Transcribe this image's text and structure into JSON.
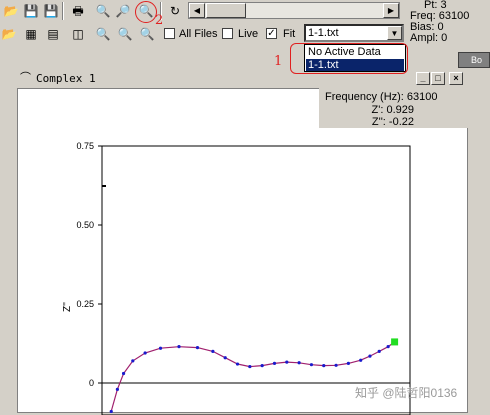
{
  "toolbar1": {
    "icons": [
      "open-icon",
      "save-icon",
      "save-all-icon",
      "print-icon",
      "zoom-fit-icon",
      "zoom-area-icon",
      "zoom-select-icon",
      "refresh-icon"
    ]
  },
  "toolbar2": {
    "icons": [
      "open-folder-icon",
      "table-icon",
      "data-grid-icon",
      "split-icon",
      "zoom-out-icon",
      "zoom-in-icon",
      "zoom-reset-icon"
    ],
    "all_files_label": "All Files",
    "live_label": "Live",
    "fit_label": "Fit",
    "all_files_checked": false,
    "live_checked": false,
    "fit_checked": true
  },
  "status": {
    "pt": "Pt: 3",
    "freq": "Freq: 63100",
    "bias": "Bias: 0",
    "ampl": "Ampl: 0"
  },
  "combo": {
    "value": "1-1.txt",
    "options": [
      "No Active Data",
      "1-1.txt"
    ],
    "selected_index": 1
  },
  "annotations": {
    "num1": "1",
    "num2": "2",
    "color": "#e02020"
  },
  "side_tab": {
    "label": "Bo"
  },
  "window": {
    "title": "Complex 1",
    "min_label": "_",
    "max_label": "□",
    "close_label": "×"
  },
  "info": {
    "freq": "Frequency (Hz): 63100",
    "zr": "Z': 0.929",
    "zi": "Z'': -0.22"
  },
  "watermark": "知乎 @陆哲阳0136",
  "chart_data": {
    "type": "line",
    "ylabel": "Z''",
    "xlabel": "",
    "ylim": [
      -0.1,
      0.75
    ],
    "yticks": [
      0,
      0.25,
      0.5,
      0.75
    ],
    "ytick_labels": [
      "0",
      "0.25",
      "0.50",
      "0.75"
    ],
    "series": [
      {
        "color": "#a0206e",
        "marker_color": "#1a1acc",
        "points": [
          [
            0.03,
            -0.09
          ],
          [
            0.05,
            -0.02
          ],
          [
            0.07,
            0.03
          ],
          [
            0.1,
            0.07
          ],
          [
            0.14,
            0.095
          ],
          [
            0.19,
            0.11
          ],
          [
            0.25,
            0.115
          ],
          [
            0.31,
            0.112
          ],
          [
            0.36,
            0.1
          ],
          [
            0.4,
            0.08
          ],
          [
            0.44,
            0.06
          ],
          [
            0.48,
            0.052
          ],
          [
            0.52,
            0.055
          ],
          [
            0.56,
            0.062
          ],
          [
            0.6,
            0.066
          ],
          [
            0.64,
            0.064
          ],
          [
            0.68,
            0.058
          ],
          [
            0.72,
            0.055
          ],
          [
            0.76,
            0.056
          ],
          [
            0.8,
            0.062
          ],
          [
            0.84,
            0.072
          ],
          [
            0.87,
            0.085
          ],
          [
            0.9,
            0.1
          ],
          [
            0.929,
            0.115
          ],
          [
            0.95,
            0.13
          ]
        ]
      }
    ],
    "highlight_point": [
      0.95,
      0.13
    ],
    "highlight_color": "#22dd22",
    "xlim": [
      0,
      1.0
    ]
  }
}
